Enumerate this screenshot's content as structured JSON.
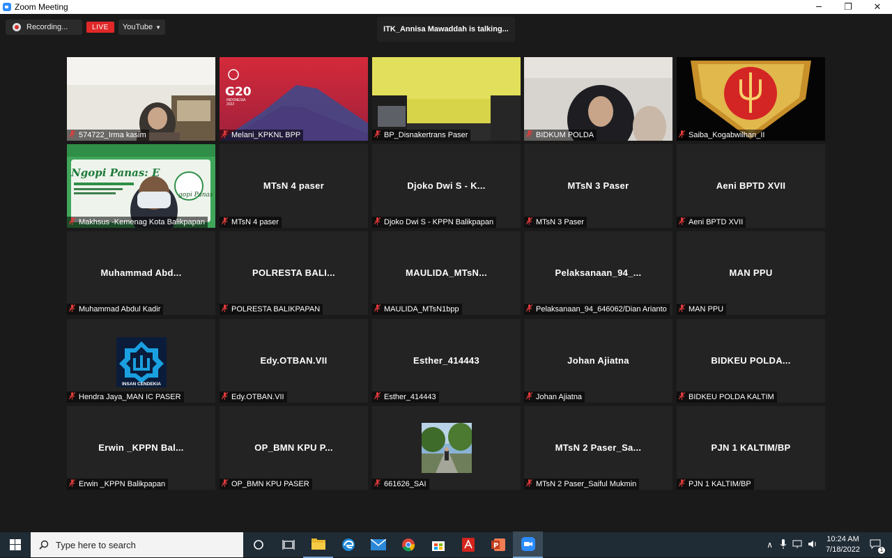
{
  "window": {
    "title": "Zoom Meeting",
    "minimize": "─",
    "restore": "❐",
    "close": "✕"
  },
  "topbar": {
    "recording_label": "Recording...",
    "live_label": "LIVE",
    "stream_label": "YouTube",
    "talking": "ITK_Annisa Mawaddah is talking..."
  },
  "tiles": [
    {
      "big": "",
      "label": "574722_Irma kasim"
    },
    {
      "big": "",
      "label": "Melani_KPKNL BPP"
    },
    {
      "big": "",
      "label": "BP_Disnakertrans Paser"
    },
    {
      "big": "",
      "label": "BIDKUM POLDA"
    },
    {
      "big": "",
      "label": "Saiba_Kogabwilhan_II"
    },
    {
      "big": "",
      "label": "Makhsus -Kemenag Kota Balikpapan"
    },
    {
      "big": "MTsN 4 paser",
      "label": "MTsN 4 paser"
    },
    {
      "big": "Djoko Dwi S - K...",
      "label": "Djoko Dwi S - KPPN Balikpapan"
    },
    {
      "big": "MTsN 3 Paser",
      "label": "MTsN 3 Paser"
    },
    {
      "big": "Aeni BPTD XVII",
      "label": "Aeni BPTD XVII"
    },
    {
      "big": "Muhammad  Abd...",
      "label": "Muhammad Abdul Kadir"
    },
    {
      "big": "POLRESTA  BALI...",
      "label": "POLRESTA BALIKPAPAN"
    },
    {
      "big": "MAULIDA_MTsN...",
      "label": "MAULIDA_MTsN1bpp"
    },
    {
      "big": "Pelaksanaan_94_...",
      "label": "Pelaksanaan_94_646062/Dian Arianto"
    },
    {
      "big": "MAN PPU",
      "label": "MAN PPU"
    },
    {
      "big": "",
      "label": "Hendra Jaya_MAN IC PASER"
    },
    {
      "big": "Edy.OTBAN.VII",
      "label": "Edy.OTBAN.VII"
    },
    {
      "big": "Esther_414443",
      "label": "Esther_414443"
    },
    {
      "big": "Johan Ajiatna",
      "label": "Johan Ajiatna"
    },
    {
      "big": "BIDKEU  POLDA...",
      "label": "BIDKEU POLDA KALTIM"
    },
    {
      "big": "Erwin  _KPPN Bal...",
      "label": "Erwin _KPPN Balikpapan"
    },
    {
      "big": "OP_BMN KPU P...",
      "label": "OP_BMN KPU PASER"
    },
    {
      "big": "",
      "label": "661626_SAI"
    },
    {
      "big": "MTsN  2  Paser_Sa...",
      "label": "MTsN 2 Paser_Saiful Mukmin"
    },
    {
      "big": "PJN 1 KALTIM/BP",
      "label": "PJN 1 KALTIM/BP"
    }
  ],
  "thumbnails": {
    "g20_text": "G20",
    "g20_sub": "INDONESIA",
    "g20_year": "2022",
    "ngopi_title": "Ngopi Panas: E",
    "ngopi_cup": "gopi Panas",
    "insan_text": "INSAN CENDEKIA"
  },
  "taskbar": {
    "search_placeholder": "Type here to search",
    "time": "10:24 AM",
    "date": "7/18/2022",
    "notif_count": "1"
  }
}
